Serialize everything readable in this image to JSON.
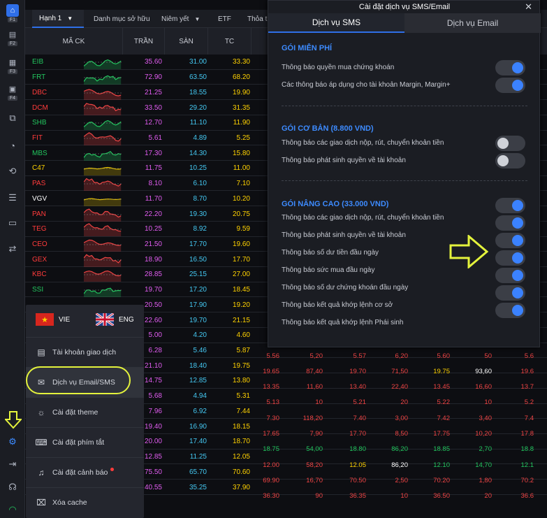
{
  "sidebar": {
    "items": [
      {
        "icon": "home-icon",
        "key": "F1"
      },
      {
        "icon": "chart-icon",
        "key": "F2"
      },
      {
        "icon": "list-icon",
        "key": "F3"
      },
      {
        "icon": "portfolio-icon",
        "key": "F4"
      }
    ],
    "icons": [
      "layers-icon",
      "pie-chart-icon",
      "exchange-icon",
      "database-icon",
      "wallet-icon",
      "transfer-icon",
      "settings-icon",
      "logout-icon",
      "headset-icon",
      "wifi-icon"
    ]
  },
  "tabs": [
    "Hạnh 1",
    "Danh mục sở hữu",
    "Niêm yết",
    "ETF",
    "Thỏa th"
  ],
  "table": {
    "headers": [
      "MÃ CK",
      "TRẦN",
      "SÀN",
      "TC"
    ],
    "rows": [
      {
        "sym": "EIB",
        "ceil": "35.60",
        "floor": "31.00",
        "ref": "33.30",
        "sc": "#22c55e"
      },
      {
        "sym": "FRT",
        "ceil": "72.90",
        "floor": "63.50",
        "ref": "68.20",
        "sc": "#22c55e"
      },
      {
        "sym": "DBC",
        "ceil": "21.25",
        "floor": "18.55",
        "ref": "19.90",
        "sc": "#ef4444"
      },
      {
        "sym": "DCM",
        "ceil": "33.50",
        "floor": "29.20",
        "ref": "31.35",
        "sc": "#ef4444"
      },
      {
        "sym": "SHB",
        "ceil": "12.70",
        "floor": "11.10",
        "ref": "11.90",
        "sc": "#22c55e"
      },
      {
        "sym": "FIT",
        "ceil": "5.61",
        "floor": "4.89",
        "ref": "5.25",
        "sc": "#ef4444"
      },
      {
        "sym": "MBS",
        "ceil": "17.30",
        "floor": "14.30",
        "ref": "15.80",
        "sc": "#22c55e"
      },
      {
        "sym": "C47",
        "ceil": "11.75",
        "floor": "10.25",
        "ref": "11.00",
        "sc": "#e5c100"
      },
      {
        "sym": "PAS",
        "ceil": "8.10",
        "floor": "6.10",
        "ref": "7.10",
        "sc": "#ef4444"
      },
      {
        "sym": "VGV",
        "ceil": "11.70",
        "floor": "8.70",
        "ref": "10.20",
        "sc": "#e5c100"
      },
      {
        "sym": "PAN",
        "ceil": "22.20",
        "floor": "19.30",
        "ref": "20.75",
        "sc": "#ef4444"
      },
      {
        "sym": "TEG",
        "ceil": "10.25",
        "floor": "8.92",
        "ref": "9.59",
        "sc": "#ef4444"
      },
      {
        "sym": "CEO",
        "ceil": "21.50",
        "floor": "17.70",
        "ref": "19.60",
        "sc": "#ef4444"
      },
      {
        "sym": "GEX",
        "ceil": "18.90",
        "floor": "16.50",
        "ref": "17.70",
        "sc": "#ef4444"
      },
      {
        "sym": "KBC",
        "ceil": "28.85",
        "floor": "25.15",
        "ref": "27.00",
        "sc": "#ef4444"
      },
      {
        "sym": "SSI",
        "ceil": "19.70",
        "floor": "17.20",
        "ref": "18.45",
        "sc": "#22c55e"
      },
      {
        "sym": "",
        "ceil": "20.50",
        "floor": "17.90",
        "ref": "19.20",
        "sc": ""
      },
      {
        "sym": "",
        "ceil": "22.60",
        "floor": "19.70",
        "ref": "21.15",
        "sc": ""
      },
      {
        "sym": "",
        "ceil": "5.00",
        "floor": "4.20",
        "ref": "4.60",
        "sc": ""
      },
      {
        "sym": "",
        "ceil": "6.28",
        "floor": "5.46",
        "ref": "5.87",
        "sc": ""
      },
      {
        "sym": "",
        "ceil": "21.10",
        "floor": "18.40",
        "ref": "19.75",
        "sc": ""
      },
      {
        "sym": "",
        "ceil": "14.75",
        "floor": "12.85",
        "ref": "13.80",
        "sc": ""
      },
      {
        "sym": "",
        "ceil": "5.68",
        "floor": "4.94",
        "ref": "5.31",
        "sc": ""
      },
      {
        "sym": "",
        "ceil": "7.96",
        "floor": "6.92",
        "ref": "7.44",
        "sc": ""
      },
      {
        "sym": "",
        "ceil": "19.40",
        "floor": "16.90",
        "ref": "18.15",
        "sc": ""
      },
      {
        "sym": "",
        "ceil": "20.00",
        "floor": "17.40",
        "ref": "18.70",
        "sc": ""
      },
      {
        "sym": "",
        "ceil": "12.85",
        "floor": "11.25",
        "ref": "12.05",
        "sc": ""
      },
      {
        "sym": "",
        "ceil": "75.50",
        "floor": "65.70",
        "ref": "70.60",
        "sc": ""
      },
      {
        "sym": "",
        "ceil": "40.55",
        "floor": "35.25",
        "ref": "37.90",
        "sc": ""
      }
    ],
    "extra_rows": [
      {
        "c": [
          "5.56",
          "5,20",
          "5.57",
          "6,20",
          "5.60",
          "50",
          "5.6"
        ],
        "col": [
          "#ef4444",
          "#ef4444",
          "#ef4444",
          "#ef4444",
          "#ef4444",
          "#ef4444",
          "#ef4444"
        ]
      },
      {
        "c": [
          "19.65",
          "87,40",
          "19.70",
          "71,50",
          "19.75",
          "93,60",
          "19.6"
        ],
        "col": [
          "#ef4444",
          "#ef4444",
          "#ef4444",
          "#ef4444",
          "#ffd200",
          "#ffffff",
          "#ef4444"
        ]
      },
      {
        "c": [
          "13.35",
          "11,60",
          "13.40",
          "22,40",
          "13.45",
          "16,60",
          "13.7"
        ],
        "col": [
          "#ef4444",
          "#ef4444",
          "#ef4444",
          "#ef4444",
          "#ef4444",
          "#ef4444",
          "#ef4444"
        ]
      },
      {
        "c": [
          "5.13",
          "10",
          "5.21",
          "20",
          "5.22",
          "10",
          "5.2"
        ],
        "col": [
          "#ef4444",
          "#ef4444",
          "#ef4444",
          "#ef4444",
          "#ef4444",
          "#ef4444",
          "#ef4444"
        ]
      },
      {
        "c": [
          "7.30",
          "118,20",
          "7.40",
          "3,00",
          "7.42",
          "3,40",
          "7.4"
        ],
        "col": [
          "#ef4444",
          "#ef4444",
          "#ef4444",
          "#ef4444",
          "#ef4444",
          "#ef4444",
          "#ef4444"
        ]
      },
      {
        "c": [
          "17.65",
          "7,90",
          "17.70",
          "8,50",
          "17.75",
          "10,20",
          "17.8"
        ],
        "col": [
          "#ef4444",
          "#ef4444",
          "#ef4444",
          "#ef4444",
          "#ef4444",
          "#ef4444",
          "#ef4444"
        ]
      },
      {
        "c": [
          "18.75",
          "54,00",
          "18.80",
          "86,20",
          "18.85",
          "2,70",
          "18.8"
        ],
        "col": [
          "#22c55e",
          "#22c55e",
          "#22c55e",
          "#22c55e",
          "#22c55e",
          "#22c55e",
          "#22c55e"
        ]
      },
      {
        "c": [
          "12.00",
          "58,20",
          "12.05",
          "86,20",
          "12.10",
          "14,70",
          "12.1"
        ],
        "col": [
          "#ef4444",
          "#ef4444",
          "#ffd200",
          "#ffffff",
          "#22c55e",
          "#22c55e",
          "#22c55e"
        ]
      },
      {
        "c": [
          "69.90",
          "16,70",
          "70.50",
          "2,50",
          "70.20",
          "1,80",
          "70.2"
        ],
        "col": [
          "#ef4444",
          "#ef4444",
          "#ef4444",
          "#ef4444",
          "#ef4444",
          "#ef4444",
          "#ef4444"
        ]
      },
      {
        "c": [
          "36.30",
          "90",
          "36.35",
          "10",
          "36.50",
          "20",
          "36.6"
        ],
        "col": [
          "#ef4444",
          "#ef4444",
          "#ef4444",
          "#ef4444",
          "#ef4444",
          "#ef4444",
          "#ef4444"
        ]
      }
    ]
  },
  "lang": {
    "vie": "VIE",
    "eng": "ENG"
  },
  "menu": [
    {
      "icon": "document-icon",
      "label": "Tài khoản giao dịch"
    },
    {
      "icon": "mail-icon",
      "label": "Dịch vụ Email/SMS"
    },
    {
      "icon": "sun-icon",
      "label": "Cài đặt theme"
    },
    {
      "icon": "keyboard-icon",
      "label": "Cài đặt phím tắt"
    },
    {
      "icon": "bell-icon",
      "label": "Cài đặt cảnh báo"
    },
    {
      "icon": "broom-icon",
      "label": "Xóa cache"
    }
  ],
  "modal": {
    "title": "Cài đặt dịch vụ SMS/Email",
    "tabs": [
      "Dịch vụ SMS",
      "Dịch vụ Email"
    ],
    "sections": [
      {
        "title": "GÓI MIỄN PHÍ",
        "options": [
          {
            "label": "Thông báo quyền mua chứng khoán",
            "on": true
          },
          {
            "label": "Các thông báo áp dụng cho tài khoản Margin, Margin+",
            "on": true
          }
        ]
      },
      {
        "title": "GÓI CƠ BẢN (8.800 VND)",
        "options": [
          {
            "label": "Thông báo các giao dịch nộp, rút, chuyển khoản tiền",
            "on": false
          },
          {
            "label": "Thông báo phát sinh quyền về tài khoản",
            "on": false
          }
        ]
      },
      {
        "title": "GÓI NÂNG CAO (33.000 VND)",
        "options": [
          {
            "label": "Thông báo các giao dịch nộp, rút, chuyển khoản tiền",
            "on": true
          },
          {
            "label": "Thông báo phát sinh quyền về tài khoản",
            "on": true
          },
          {
            "label": "Thông báo số dư tiền đầu ngày",
            "on": true
          },
          {
            "label": "Thông báo sức mua đầu ngày",
            "on": true
          },
          {
            "label": "Thông báo số dư chứng khoán đầu ngày",
            "on": true
          },
          {
            "label": "Thông báo kết quả khớp lệnh cơ sở",
            "on": true
          },
          {
            "label": "Thông báo kết quả khớp lệnh Phái sinh",
            "on": true
          }
        ]
      }
    ]
  },
  "colors": {
    "accent": "#2f6fe8",
    "highlight": "#e4f33c",
    "ceiling": "#e05cf0",
    "floor": "#44c8f2",
    "reference": "#ffd200"
  }
}
